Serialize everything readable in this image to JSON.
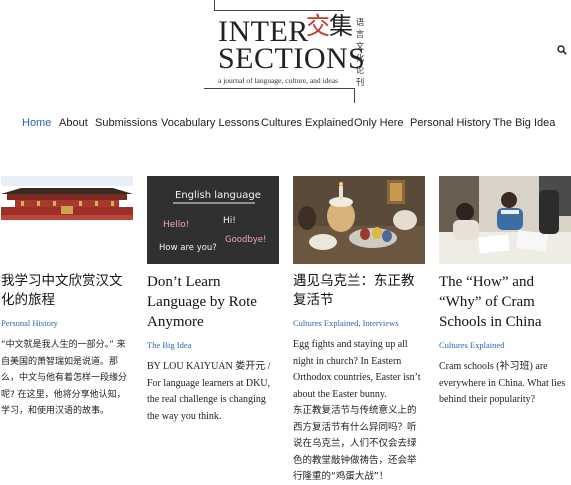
{
  "site": {
    "logo_line1": "INTER",
    "logo_line2": "SECTIONS",
    "logo_cn_red": "交",
    "logo_cn_black": "集",
    "logo_subtitle": "a journal of language, culture, and ideas",
    "logo_vertical": "语言文化论刊",
    "accent_color": "#2a64b4"
  },
  "nav": {
    "items": [
      {
        "label": "Home",
        "active": true
      },
      {
        "label": "About"
      },
      {
        "label": "Submissions"
      },
      {
        "label": "Vocabulary Lessons"
      },
      {
        "label": "Cultures Explained"
      },
      {
        "label": "Only Here"
      },
      {
        "label": "Personal History"
      },
      {
        "label": "The Big Idea"
      }
    ]
  },
  "icons": {
    "search": "search-icon"
  },
  "cards": [
    {
      "title": "我学习中文欣赏汉文化的旅程",
      "category": "Personal History",
      "excerpt": "“中文就是我人生的一部分。” 来自美国的萧智瑞如是说道。那么，中文与他有着怎样一段缘分呢? 在这里，他将分享他认知，学习，和使用汉语的故事。"
    },
    {
      "title": "Don’t Learn Language by Rote Anymore",
      "category": "The Big Idea",
      "excerpt": "BY LOU KAIYUAN 娄开元 / For language learners at DKU, the real challenge is changing the way you think.",
      "image_text": {
        "heading": "English language",
        "hello": "Hello!",
        "hi": "Hi!",
        "how": "How are you?",
        "goodbye": "Goodbye!"
      }
    },
    {
      "title": "遇见乌克兰：东正教复活节",
      "category": "Cultures Explained, Interviews",
      "excerpt_en": "Egg fights and staying up all night in church? In Eastern Orthodox countries, Easter isn’t about the Easter bunny.",
      "excerpt_cn": "东正教复活节与传统意义上的西方复活节有什么异同吗？听说在乌克兰，人们不仅会去绿色的教堂敲钟做祷告，还会举行隆重的“鸡蛋大战”！"
    },
    {
      "title": "The “How” and “Why” of Cram Schools in China",
      "category": "Cultures Explained",
      "excerpt": "Cram schools (补习班) are everywhere in China. What lies behind their popularity?"
    }
  ]
}
